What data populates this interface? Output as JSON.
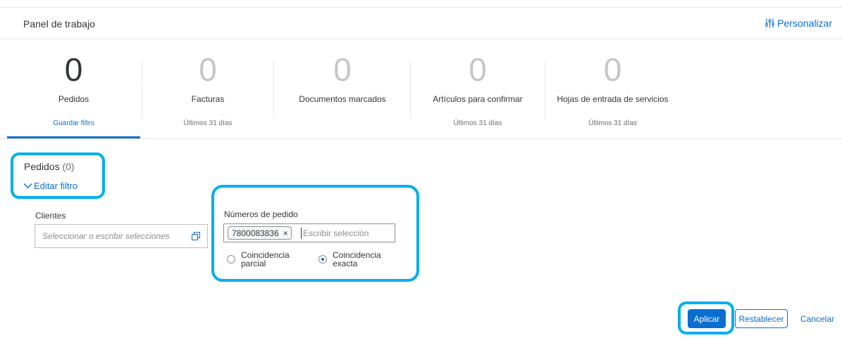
{
  "header": {
    "title": "Panel de trabajo",
    "personalize_label": "Personalizar"
  },
  "tiles": [
    {
      "count": "0",
      "label": "Pedidos",
      "sub": "Guardar filtro",
      "active": true
    },
    {
      "count": "0",
      "label": "Facturas",
      "sub": "Últimos 31 días"
    },
    {
      "count": "0",
      "label": "Documentos marcados",
      "sub": ""
    },
    {
      "count": "0",
      "label": "Artículos para confirmar",
      "sub": "Últimos 31 días"
    },
    {
      "count": "0",
      "label": "Hojas de entrada de servicios",
      "sub": "Últimos 31 días"
    }
  ],
  "section": {
    "title": "Pedidos",
    "count": "(0)",
    "edit_filter_label": "Editar filtro"
  },
  "filters": {
    "clients": {
      "label": "Clientes",
      "placeholder": "Seleccionar o escribir selecciones"
    },
    "orders": {
      "label": "Números de pedido",
      "token": "7800083836",
      "token_remove": "×",
      "placeholder": "Escribir selección",
      "match_partial": "Coincidencia parcial",
      "match_exact": "Coincidencia exacta",
      "selected_match": "exacta"
    }
  },
  "actions": {
    "apply": "Aplicar",
    "reset": "Restablecer",
    "cancel": "Cancelar"
  },
  "colors": {
    "accent": "#0a6ed1",
    "highlight": "#00aeef"
  },
  "icons": [
    "personalize-icon",
    "chevron-down-icon",
    "value-help-icon",
    "token-remove-icon"
  ]
}
